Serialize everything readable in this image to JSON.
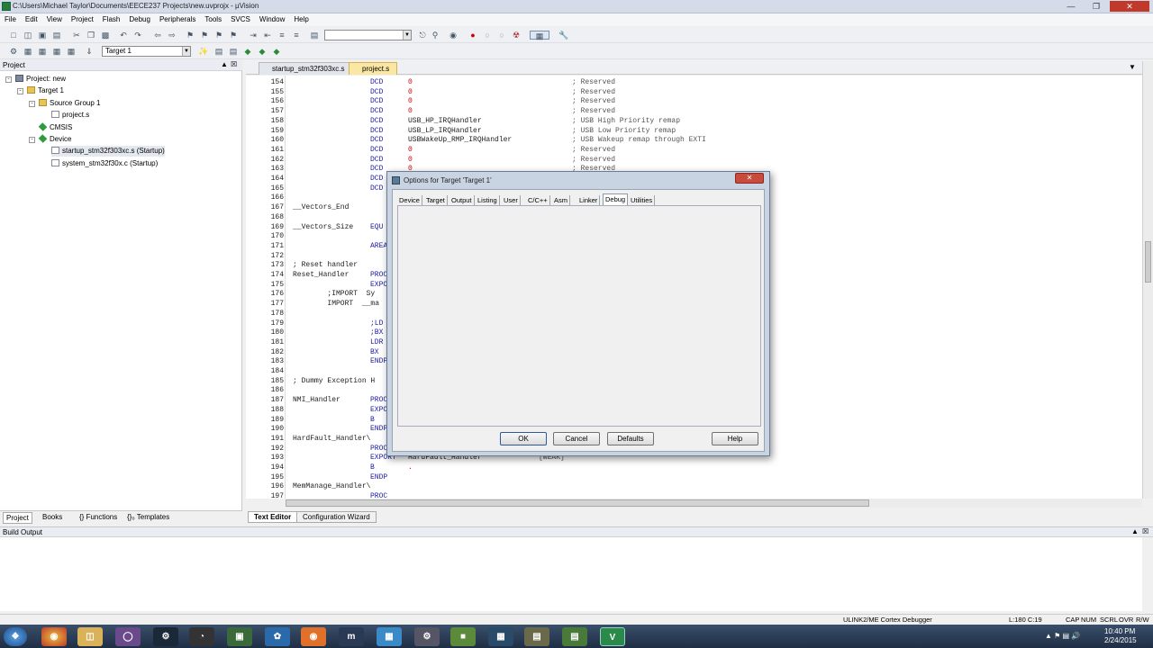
{
  "window": {
    "title": "C:\\Users\\Michael Taylor\\Documents\\EECE237 Projects\\new.uvprojx - µVision"
  },
  "menu": [
    "File",
    "Edit",
    "View",
    "Project",
    "Flash",
    "Debug",
    "Peripherals",
    "Tools",
    "SVCS",
    "Window",
    "Help"
  ],
  "toolbar2": {
    "target_select": "Target 1"
  },
  "project_panel": {
    "header": "Project",
    "tree": [
      "Project: new",
      "Target 1",
      "Source Group 1",
      "project.s",
      "CMSIS",
      "Device",
      "startup_stm32f303xc.s (Startup)",
      "system_stm32f30x.c (Startup)"
    ],
    "tabs": [
      "Project",
      "Books",
      "{} Functions",
      "{}₀ Templates"
    ]
  },
  "editor": {
    "tabs": [
      "startup_stm32f303xc.s",
      "project.s"
    ],
    "bottom_tabs": [
      "Text Editor",
      "Configuration Wizard"
    ],
    "lines": [
      {
        "n": "154",
        "label": "",
        "op": "DCD",
        "arg": "0",
        "cmt": "; Reserved"
      },
      {
        "n": "155",
        "label": "",
        "op": "DCD",
        "arg": "0",
        "cmt": "; Reserved"
      },
      {
        "n": "156",
        "label": "",
        "op": "DCD",
        "arg": "0",
        "cmt": "; Reserved"
      },
      {
        "n": "157",
        "label": "",
        "op": "DCD",
        "arg": "0",
        "cmt": "; Reserved"
      },
      {
        "n": "158",
        "label": "",
        "op": "DCD",
        "arg": "USB_HP_IRQHandler",
        "cmt": "; USB High Priority remap"
      },
      {
        "n": "159",
        "label": "",
        "op": "DCD",
        "arg": "USB_LP_IRQHandler",
        "cmt": "; USB Low Priority remap"
      },
      {
        "n": "160",
        "label": "",
        "op": "DCD",
        "arg": "USBWakeUp_RMP_IRQHandler",
        "cmt": "; USB Wakeup remap through EXTI"
      },
      {
        "n": "161",
        "label": "",
        "op": "DCD",
        "arg": "0",
        "cmt": "; Reserved"
      },
      {
        "n": "162",
        "label": "",
        "op": "DCD",
        "arg": "0",
        "cmt": "; Reserved"
      },
      {
        "n": "163",
        "label": "",
        "op": "DCD",
        "arg": "0",
        "cmt": "; Reserved"
      },
      {
        "n": "164",
        "label": "",
        "op": "DCD",
        "arg": "",
        "cmt": ""
      },
      {
        "n": "165",
        "label": "",
        "op": "DCD",
        "arg": "",
        "cmt": ""
      },
      {
        "n": "166",
        "label": "",
        "op": "",
        "arg": "",
        "cmt": ""
      },
      {
        "n": "167",
        "label": "__Vectors_End",
        "op": "",
        "arg": "",
        "cmt": ""
      },
      {
        "n": "168",
        "label": "",
        "op": "",
        "arg": "",
        "cmt": ""
      },
      {
        "n": "169",
        "label": "__Vectors_Size",
        "op": "EQU",
        "arg": "",
        "cmt": ""
      },
      {
        "n": "170",
        "label": "",
        "op": "",
        "arg": "",
        "cmt": ""
      },
      {
        "n": "171",
        "label": "",
        "op": "AREA",
        "arg": "",
        "cmt": ""
      },
      {
        "n": "172",
        "label": "",
        "op": "",
        "arg": "",
        "cmt": ""
      },
      {
        "n": "173",
        "label": "; Reset handler",
        "op": "",
        "arg": "",
        "cmt": ""
      },
      {
        "n": "174",
        "label": "Reset_Handler",
        "op": "PROC",
        "arg": "",
        "cmt": ""
      },
      {
        "n": "175",
        "label": "",
        "op": "EXPORT",
        "arg": "",
        "cmt": ""
      },
      {
        "n": "176",
        "label": "        ;IMPORT  Sy",
        "op": "",
        "arg": "",
        "cmt": ""
      },
      {
        "n": "177",
        "label": "        IMPORT  __ma",
        "op": "",
        "arg": "",
        "cmt": ""
      },
      {
        "n": "178",
        "label": "",
        "op": "",
        "arg": "",
        "cmt": ""
      },
      {
        "n": "179",
        "label": "",
        "op": ";LD",
        "arg": "",
        "cmt": ""
      },
      {
        "n": "180",
        "label": "",
        "op": ";BX",
        "arg": "",
        "cmt": ""
      },
      {
        "n": "181",
        "label": "",
        "op": "LDR",
        "arg": "",
        "cmt": ""
      },
      {
        "n": "182",
        "label": "",
        "op": "BX",
        "arg": "",
        "cmt": ""
      },
      {
        "n": "183",
        "label": "",
        "op": "ENDP",
        "arg": "",
        "cmt": ""
      },
      {
        "n": "184",
        "label": "",
        "op": "",
        "arg": "",
        "cmt": ""
      },
      {
        "n": "185",
        "label": "; Dummy Exception H",
        "op": "",
        "arg": "",
        "cmt": ""
      },
      {
        "n": "186",
        "label": "",
        "op": "",
        "arg": "",
        "cmt": ""
      },
      {
        "n": "187",
        "label": "NMI_Handler",
        "op": "PROC",
        "arg": "",
        "cmt": ""
      },
      {
        "n": "188",
        "label": "",
        "op": "EXPORT",
        "arg": "",
        "cmt": ""
      },
      {
        "n": "189",
        "label": "",
        "op": "B",
        "arg": "",
        "cmt": ""
      },
      {
        "n": "190",
        "label": "",
        "op": "ENDP",
        "arg": "",
        "cmt": ""
      },
      {
        "n": "191",
        "label": "HardFault_Handler\\",
        "op": "",
        "arg": "",
        "cmt": ""
      },
      {
        "n": "192",
        "label": "",
        "op": "PROC",
        "arg": "",
        "cmt": ""
      },
      {
        "n": "193",
        "label": "",
        "op": "EXPORT",
        "arg": "HardFault_Handler",
        "cmt": "[WEAK]"
      },
      {
        "n": "194",
        "label": "",
        "op": "B",
        "arg": ".",
        "cmt": ""
      },
      {
        "n": "195",
        "label": "",
        "op": "ENDP",
        "arg": "",
        "cmt": ""
      },
      {
        "n": "196",
        "label": "MemManage_Handler\\",
        "op": "",
        "arg": "",
        "cmt": ""
      },
      {
        "n": "197",
        "label": "",
        "op": "PROC",
        "arg": "",
        "cmt": ""
      }
    ]
  },
  "dialog": {
    "title": "Options for Target 'Target 1'",
    "tabs": [
      "Device",
      "Target",
      "Output",
      "Listing",
      "User",
      "C/C++",
      "Asm",
      "Linker",
      "Debug",
      "Utilities"
    ],
    "buttons": {
      "ok": "OK",
      "cancel": "Cancel",
      "defaults": "Defaults",
      "help": "Help"
    }
  },
  "build_output": {
    "header": "Build Output"
  },
  "status": {
    "debugger": "ULINK2/ME Cortex Debugger",
    "position": "L:180 C:19",
    "flags": [
      "CAP",
      "NUM",
      "SCRL",
      "OVR",
      "R/W"
    ]
  },
  "taskbar": {
    "time": "10:40 PM",
    "date": "2/24/2015"
  },
  "colors": {
    "keyword": "#1a1aa6",
    "number": "#c00000",
    "comment": "#555555"
  }
}
